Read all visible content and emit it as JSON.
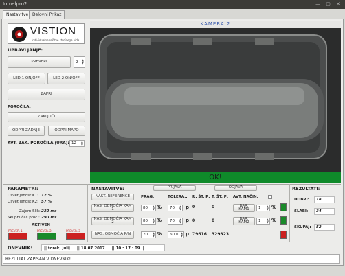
{
  "window": {
    "title": "Iomelpro2"
  },
  "tabs": [
    {
      "label": "Nastavitve"
    },
    {
      "label": "Delovni Prikaz"
    }
  ],
  "brand": {
    "name": "VISTION",
    "tagline": "individualne rešitve strojnega vida"
  },
  "controls": {
    "heading": "UPRAVLJANJE:",
    "preveri": "PREVERI",
    "cam_select": "2",
    "led1": "LED 1 ON/OFF",
    "led2": "LED 2 ON/OFF",
    "zapri": "ZAPRI",
    "reports_heading": "POROČILA:",
    "zakljuci": "ZAKLJUČI",
    "odpri_zadnje": "ODPRI ZADNJE",
    "odpri_mapo": "ODPRI MAPO",
    "auto_close_label": "AVT. ZAK. POROČILA (URA):",
    "auto_close_value": "12"
  },
  "camera": {
    "title": "KAMERA 2",
    "result": "OK!",
    "result_color": "#0f8a2a"
  },
  "params": {
    "heading": "PARAMETRI:",
    "rows": [
      {
        "label": "Osvetljenost K1:",
        "value": "12 %"
      },
      {
        "label": "Osvetljenost K2:",
        "value": "57 %"
      },
      {
        "label": "Zajem Slik:",
        "value": "232 ms"
      },
      {
        "label": "Skupni čas proc.:",
        "value": "290 ms"
      }
    ],
    "active_heading": "AKTIVEN",
    "checks": [
      {
        "label": "PREVER. 1",
        "color": "#cc2020"
      },
      {
        "label": "PREVER. 2",
        "color": "#1a8a2a"
      },
      {
        "label": "PREVER. 3",
        "color": "#cc2020"
      }
    ]
  },
  "settings": {
    "heading": "NASTAVITVE:",
    "prijava": "PRIJAVA",
    "odjava": "ODJAVA",
    "nast_reference": "NAST. REFERENCE",
    "col_prag": "PRAG:",
    "col_toler": "TOLERA.:",
    "col_rst": "R. ŠT. P:",
    "col_tst": "T. ŠT. P:",
    "col_avt": "AVT. NAČIN:",
    "rows": [
      {
        "btn": "NAS. OBMOČJA KAM 1",
        "prag": "80",
        "pct": "%",
        "toler": "70",
        "p": "p",
        "rst": "0",
        "tst": "0",
        "bar": "BAR. KAM1",
        "bar_val": "1",
        "bar_pct": "%",
        "color": "#1a8a2a"
      },
      {
        "btn": "NAS. OBMOČJA KAM 2",
        "prag": "80",
        "pct": "%",
        "toler": "70",
        "p": "p",
        "rst": "0",
        "tst": "0",
        "bar": "BAR. KAM2",
        "bar_val": "1",
        "bar_pct": "%",
        "color": "#1a8a2a"
      },
      {
        "btn": "NAS. OBMOČJA P/N",
        "prag": "70",
        "pct": "%",
        "toler": "6000",
        "p": "p",
        "rst": "79616",
        "tst": "329323",
        "bar": "",
        "bar_val": "",
        "bar_pct": "",
        "color": "#cc2020"
      }
    ]
  },
  "results": {
    "heading": "REZULTATI:",
    "rows": [
      {
        "label": "DOBRI:",
        "value": "18"
      },
      {
        "label": "SLABI:",
        "value": "34"
      },
      {
        "label": "SKUPAJ:",
        "value": "52"
      }
    ]
  },
  "log": {
    "heading": "DNEVNIK:",
    "day": "|| torek, julij",
    "date": "|| 18.07.2017",
    "time": "|| 10 : 17 : 09 ||",
    "message": "REZULTAT ZAPISAN V DNEVNIK!"
  }
}
